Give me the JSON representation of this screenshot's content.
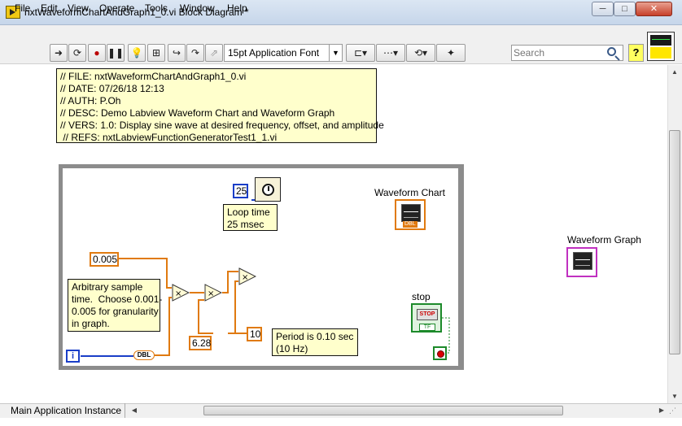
{
  "window": {
    "title": "nxtWaveformChartAndGraph1_0.vi Block Diagram *",
    "minimize": "─",
    "maximize": "□",
    "close": "✕"
  },
  "menu": [
    "File",
    "Edit",
    "View",
    "Operate",
    "Tools",
    "Window",
    "Help"
  ],
  "toolbar": {
    "font": "15pt Application Font",
    "search_placeholder": "Search",
    "help": "?"
  },
  "comment": {
    "lines": "// FILE: nxtWaveformChartAndGraph1_0.vi\n// DATE: 07/26/18 12:13\n// AUTH: P.Oh\n// DESC: Demo Labview Waveform Chart and Waveform Graph\n// VERS: 1.0: Display sine wave at desired frequency, offset, and amplitude\n // REFS: nxtLabviewFunctionGeneratorTest1_1.vi"
  },
  "diagram": {
    "wait_const": "25",
    "loop_time_note": "Loop time\n25 msec",
    "waveform_chart_label": "Waveform Chart",
    "waveform_graph_label": "Waveform Graph",
    "sample_time_const": "0.005",
    "sample_note": "Arbitrary sample\ntime.  Choose 0.001-\n0.005 for granularity\nin graph.",
    "two_pi_const": "6.28",
    "period_const": "10",
    "period_note": "Period is 0.10 sec\n(10 Hz)",
    "stop_label": "stop",
    "stop_button": "STOP",
    "tf_tag": "TF",
    "dbl_tag": "DBL",
    "iteration": "i",
    "multiply_symbol": "×"
  },
  "status": {
    "context": "Main Application Instance"
  }
}
